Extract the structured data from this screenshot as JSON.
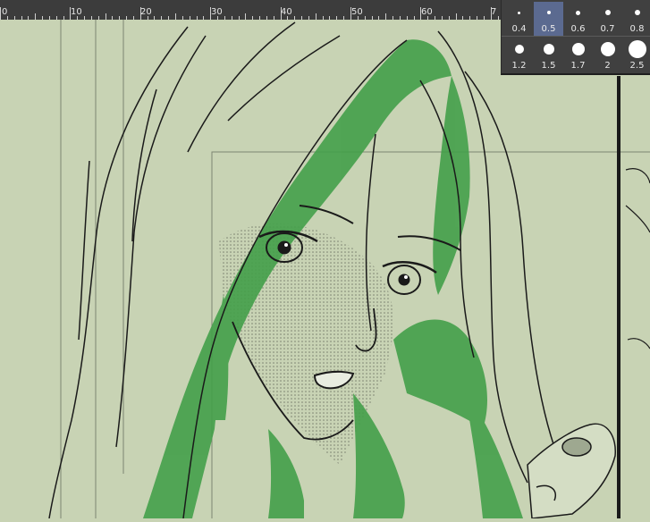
{
  "ruler": {
    "labels": [
      "0",
      "10",
      "20",
      "30",
      "40",
      "50",
      "60",
      "7"
    ]
  },
  "brush_sizes": [
    {
      "label": "0.4",
      "size": 0.4,
      "selected": false
    },
    {
      "label": "0.5",
      "size": 0.5,
      "selected": true
    },
    {
      "label": "0.6",
      "size": 0.6,
      "selected": false
    },
    {
      "label": "0.7",
      "size": 0.7,
      "selected": false
    },
    {
      "label": "0.8",
      "size": 0.8,
      "selected": false
    },
    {
      "label": "1.2",
      "size": 1.2,
      "selected": false
    },
    {
      "label": "1.5",
      "size": 1.5,
      "selected": false
    },
    {
      "label": "1.7",
      "size": 1.7,
      "selected": false
    },
    {
      "label": "2",
      "size": 2,
      "selected": false
    },
    {
      "label": "2.5",
      "size": 2.5,
      "selected": false
    }
  ],
  "colors": {
    "canvas_bg": "#c8d3b4",
    "hair_tone": "#44a04a",
    "ink": "#1a1a1a",
    "ruler_bg": "#3c3c3c",
    "palette_bg": "#404040",
    "selected_cell": "#5b6a90"
  }
}
